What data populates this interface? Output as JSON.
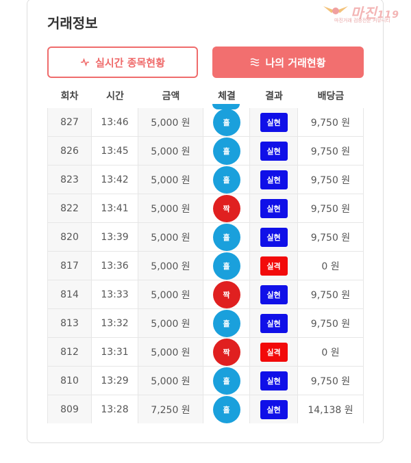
{
  "header": {
    "title": "거래정보"
  },
  "logo": {
    "text": "마진",
    "suffix": "119",
    "subtitle": "마진거래 검증전문 커뮤니티"
  },
  "tabs": {
    "live_label": "실시간 종목현황",
    "mine_label": "나의 거래현황"
  },
  "columns": [
    "회차",
    "시간",
    "금액",
    "체결",
    "결과",
    "배당금"
  ],
  "colors": {
    "accent": "#f26f6f",
    "blue_ball": "#1aa0dc",
    "red_ball": "#e02020",
    "win": "#1010e8",
    "lose": "#f20a0a"
  },
  "rows": [
    {
      "round": "827",
      "time": "13:46",
      "amount": "5,000 원",
      "pick": "홀",
      "pick_color": "blue",
      "result": "실현",
      "result_type": "win",
      "payout": "9,750 원"
    },
    {
      "round": "826",
      "time": "13:45",
      "amount": "5,000 원",
      "pick": "홀",
      "pick_color": "blue",
      "result": "실현",
      "result_type": "win",
      "payout": "9,750 원"
    },
    {
      "round": "823",
      "time": "13:42",
      "amount": "5,000 원",
      "pick": "홀",
      "pick_color": "blue",
      "result": "실현",
      "result_type": "win",
      "payout": "9,750 원"
    },
    {
      "round": "822",
      "time": "13:41",
      "amount": "5,000 원",
      "pick": "짝",
      "pick_color": "red",
      "result": "실현",
      "result_type": "win",
      "payout": "9,750 원"
    },
    {
      "round": "820",
      "time": "13:39",
      "amount": "5,000 원",
      "pick": "홀",
      "pick_color": "blue",
      "result": "실현",
      "result_type": "win",
      "payout": "9,750 원"
    },
    {
      "round": "817",
      "time": "13:36",
      "amount": "5,000 원",
      "pick": "홀",
      "pick_color": "blue",
      "result": "실격",
      "result_type": "lose",
      "payout": "0 원"
    },
    {
      "round": "814",
      "time": "13:33",
      "amount": "5,000 원",
      "pick": "짝",
      "pick_color": "red",
      "result": "실현",
      "result_type": "win",
      "payout": "9,750 원"
    },
    {
      "round": "813",
      "time": "13:32",
      "amount": "5,000 원",
      "pick": "홀",
      "pick_color": "blue",
      "result": "실현",
      "result_type": "win",
      "payout": "9,750 원"
    },
    {
      "round": "812",
      "time": "13:31",
      "amount": "5,000 원",
      "pick": "짝",
      "pick_color": "red",
      "result": "실격",
      "result_type": "lose",
      "payout": "0 원"
    },
    {
      "round": "810",
      "time": "13:29",
      "amount": "5,000 원",
      "pick": "홀",
      "pick_color": "blue",
      "result": "실현",
      "result_type": "win",
      "payout": "9,750 원"
    },
    {
      "round": "809",
      "time": "13:28",
      "amount": "7,250 원",
      "pick": "홀",
      "pick_color": "blue",
      "result": "실현",
      "result_type": "win",
      "payout": "14,138 원"
    }
  ]
}
